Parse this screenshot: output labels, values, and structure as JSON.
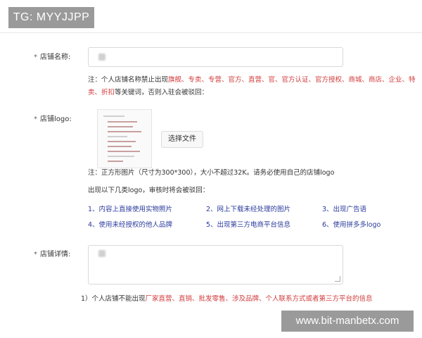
{
  "watermark_top": "TG: MYYJJPP",
  "watermark_bottom": "www.bit-manbetx.com",
  "store_name": {
    "star": "*",
    "label": "店铺名称:",
    "note_prefix": "注：个人店铺名称禁止出现",
    "note_red_1": "旗舰、专卖、专营、官方、直营、官、官方认证、官方授权、商城、商店、企业、特",
    "note_red_2": "卖、折扣",
    "note_suffix": "等关键词，否则入驻会被驳回："
  },
  "store_logo": {
    "star": "*",
    "label": "店铺logo:",
    "file_button": "选择文件",
    "note": "注：正方形图片（尺寸为300*300），大小不超过32K。请务必使用自己的店铺logo",
    "reject_heading": "出现以下几类logo，审核时将会被驳回：",
    "reject_items": [
      "1、内容上直接使用实物照片",
      "2、网上下载未经处理的图片",
      "3、出现广告语",
      "4、使用未经授权的他人品牌",
      "5、出现第三方电商平台信息",
      "6、使用拼多多logo"
    ]
  },
  "store_detail": {
    "star": "*",
    "label": "店铺详情:",
    "bottom_prefix": "1）个人店铺不能出现",
    "bottom_red": "厂家直营、直销、批发零售、涉及品牌、个人联系方式或者第三方平台的信息"
  }
}
